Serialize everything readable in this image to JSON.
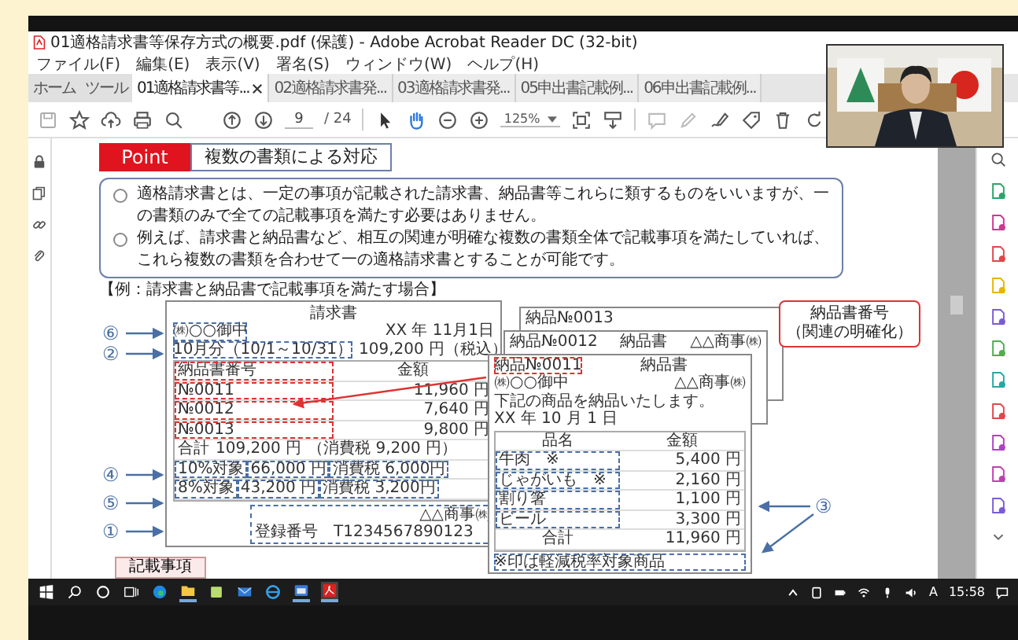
{
  "window": {
    "title": "01適格請求書等保存方式の概要.pdf (保護) - Adobe Acrobat Reader DC (32-bit)"
  },
  "menu": [
    "ファイル(F)",
    "編集(E)",
    "表示(V)",
    "署名(S)",
    "ウィンドウ(W)",
    "ヘルプ(H)"
  ],
  "tabs": [
    {
      "label": "ホーム",
      "selected": false
    },
    {
      "label": "ツール",
      "selected": false
    },
    {
      "label": "01適格請求書等...",
      "selected": true
    },
    {
      "label": "02適格請求書発...",
      "selected": false
    },
    {
      "label": "03適格請求書発...",
      "selected": false
    },
    {
      "label": "05申出書記載例...",
      "selected": false
    },
    {
      "label": "06申出書記載例...",
      "selected": false
    }
  ],
  "toolbar": {
    "page": "9",
    "total": "/ 24",
    "zoom": "125%"
  },
  "document": {
    "point_label": "Point",
    "heading": "複数の書類による対応",
    "bullets": [
      "適格請求書とは、一定の事項が記載された請求書、納品書等これらに類するものをいいますが、一の書類のみで全ての記載事項を満たす必要はありません。",
      "例えば、請求書と納品書など、相互の関連が明確な複数の書類全体で記載事項を満たしていれば、これら複数の書類を合わせて一の適格請求書とすることが可能です。"
    ],
    "example_caption": "【例：請求書と納品書で記載事項を満たす場合】",
    "markers": [
      "⑥",
      "②",
      "④",
      "⑤",
      "①"
    ],
    "invoice": {
      "title": "請求書",
      "addressee": "㈱○○御中",
      "date": "XX 年 11月1日",
      "period": "10月分（10/1～10/31）",
      "total": "109,200 円（税込）",
      "columns": [
        "納品書番号",
        "金額"
      ],
      "rows": [
        {
          "number": "№0011",
          "amount": "11,960 円"
        },
        {
          "number": "№0012",
          "amount": "7,640 円"
        },
        {
          "number": "№0013",
          "amount": "9,800 円"
        }
      ],
      "summary": {
        "label": "合計",
        "amount": "109,200 円",
        "tax": "（消費税 9,200 円）"
      },
      "rates": [
        {
          "label": "10%対象",
          "amount": "66,000 円",
          "tax": "消費税 6,000円"
        },
        {
          "label": "8%対象",
          "amount": "43,200 円",
          "tax": "消費税 3,200円"
        }
      ],
      "issuer": "△△商事㈱",
      "registration": "登録番号　T1234567890123"
    },
    "delivery_notes": {
      "back": [
        {
          "number": "納品№0013"
        },
        {
          "number": "納品№0012",
          "title": "納品書",
          "issuer": "△△商事㈱"
        }
      ],
      "front": {
        "number": "納品№0011",
        "title": "納品書",
        "addressee": "㈱○○御中",
        "issuer": "△△商事㈱",
        "message": "下記の商品を納品いたします。",
        "date": "XX 年 10 月 1 日",
        "columns": [
          "品名",
          "金額"
        ],
        "items": [
          {
            "name": "牛肉　※",
            "amount": "5,400 円"
          },
          {
            "name": "じゃがいも　※",
            "amount": "2,160 円"
          },
          {
            "name": "割り箸",
            "amount": "1,100 円"
          },
          {
            "name": "ビール",
            "amount": "3,300 円"
          }
        ],
        "total_label": "合計",
        "total": "11,960 円",
        "footnote": "※印は軽減税率対象商品"
      }
    },
    "callout": {
      "title": "納品書番号",
      "subtitle": "（関連の明確化）"
    },
    "note_marker": "③",
    "footer_tab": "記載事項"
  },
  "taskbar": {
    "ime": "A",
    "time": "15:58"
  },
  "video": {
    "kind": "picture"
  }
}
